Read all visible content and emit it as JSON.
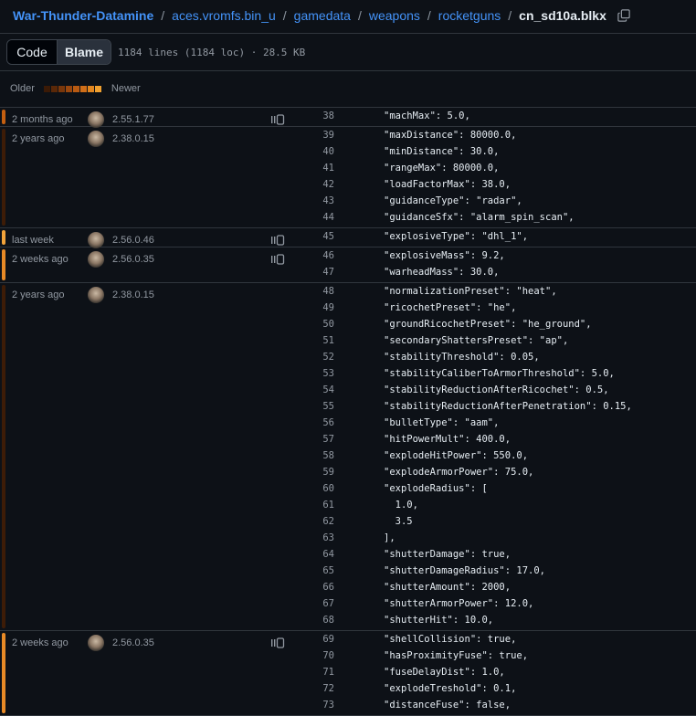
{
  "breadcrumb": {
    "repo": "War-Thunder-Datamine",
    "crumbs": [
      "aces.vromfs.bin_u",
      "gamedata",
      "weapons",
      "rocketguns"
    ],
    "file": "cn_sd10a.blkx"
  },
  "toolbar": {
    "code_label": "Code",
    "blame_label": "Blame",
    "meta": "1184 lines (1184 loc) · 28.5 KB"
  },
  "legend": {
    "older": "Older",
    "newer": "Newer",
    "scale_colors": [
      "#3b1a06",
      "#5a2808",
      "#7a370b",
      "#9a470e",
      "#b85a12",
      "#d06e18",
      "#e2861f",
      "#f0a030"
    ]
  },
  "hunks": [
    {
      "when": "2 months ago",
      "version": "2.55.1.77",
      "bar_color": "#c45f10",
      "reblame": true,
      "lines": [
        {
          "n": "38",
          "code": "\"machMax\": 5.0,"
        }
      ]
    },
    {
      "when": "2 years ago",
      "version": "2.38.0.15",
      "bar_color": "#3d1c07",
      "reblame": false,
      "lines": [
        {
          "n": "39",
          "code": "\"maxDistance\": 80000.0,"
        },
        {
          "n": "40",
          "code": "\"minDistance\": 30.0,"
        },
        {
          "n": "41",
          "code": "\"rangeMax\": 80000.0,"
        },
        {
          "n": "42",
          "code": "\"loadFactorMax\": 38.0,"
        },
        {
          "n": "43",
          "code": "\"guidanceType\": \"radar\","
        },
        {
          "n": "44",
          "code": "\"guidanceSfx\": \"alarm_spin_scan\","
        }
      ]
    },
    {
      "when": "last week",
      "version": "2.56.0.46",
      "bar_color": "#f2a33a",
      "reblame": true,
      "lines": [
        {
          "n": "45",
          "code": "\"explosiveType\": \"dhl_1\","
        }
      ]
    },
    {
      "when": "2 weeks ago",
      "version": "2.56.0.35",
      "bar_color": "#e88a26",
      "reblame": true,
      "lines": [
        {
          "n": "46",
          "code": "\"explosiveMass\": 9.2,"
        },
        {
          "n": "47",
          "code": "\"warheadMass\": 30.0,"
        }
      ]
    },
    {
      "when": "2 years ago",
      "version": "2.38.0.15",
      "bar_color": "#3d1c07",
      "reblame": false,
      "lines": [
        {
          "n": "48",
          "code": "\"normalizationPreset\": \"heat\","
        },
        {
          "n": "49",
          "code": "\"ricochetPreset\": \"he\","
        },
        {
          "n": "50",
          "code": "\"groundRicochetPreset\": \"he_ground\","
        },
        {
          "n": "51",
          "code": "\"secondaryShattersPreset\": \"ap\","
        },
        {
          "n": "52",
          "code": "\"stabilityThreshold\": 0.05,"
        },
        {
          "n": "53",
          "code": "\"stabilityCaliberToArmorThreshold\": 5.0,"
        },
        {
          "n": "54",
          "code": "\"stabilityReductionAfterRicochet\": 0.5,"
        },
        {
          "n": "55",
          "code": "\"stabilityReductionAfterPenetration\": 0.15,"
        },
        {
          "n": "56",
          "code": "\"bulletType\": \"aam\","
        },
        {
          "n": "57",
          "code": "\"hitPowerMult\": 400.0,"
        },
        {
          "n": "58",
          "code": "\"explodeHitPower\": 550.0,"
        },
        {
          "n": "59",
          "code": "\"explodeArmorPower\": 75.0,"
        },
        {
          "n": "60",
          "code": "\"explodeRadius\": ["
        },
        {
          "n": "61",
          "code": "  1.0,"
        },
        {
          "n": "62",
          "code": "  3.5"
        },
        {
          "n": "63",
          "code": "],"
        },
        {
          "n": "64",
          "code": "\"shutterDamage\": true,"
        },
        {
          "n": "65",
          "code": "\"shutterDamageRadius\": 17.0,"
        },
        {
          "n": "66",
          "code": "\"shutterAmount\": 2000,"
        },
        {
          "n": "67",
          "code": "\"shutterArmorPower\": 12.0,"
        },
        {
          "n": "68",
          "code": "\"shutterHit\": 10.0,"
        }
      ]
    },
    {
      "when": "2 weeks ago",
      "version": "2.56.0.35",
      "bar_color": "#e88a26",
      "reblame": true,
      "lines": [
        {
          "n": "69",
          "code": "\"shellCollision\": true,"
        },
        {
          "n": "70",
          "code": "\"hasProximityFuse\": true,"
        },
        {
          "n": "71",
          "code": "\"fuseDelayDist\": 1.0,"
        },
        {
          "n": "72",
          "code": "\"explodeTreshold\": 0.1,"
        },
        {
          "n": "73",
          "code": "\"distanceFuse\": false,"
        }
      ]
    }
  ]
}
